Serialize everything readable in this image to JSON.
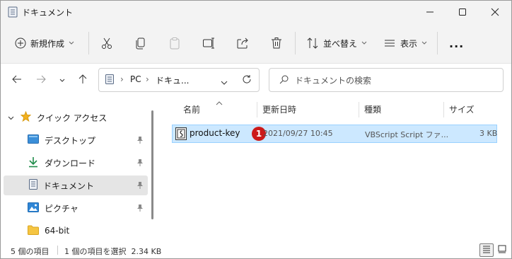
{
  "window": {
    "title": "ドキュメント",
    "title_icon": "document-folder-icon"
  },
  "toolbar": {
    "new_label": "新規作成",
    "sort_label": "並べ替え",
    "view_label": "表示",
    "more_label": "..."
  },
  "address": {
    "segments": [
      "PC",
      "ドキュ..."
    ]
  },
  "search": {
    "placeholder": "ドキュメントの検索"
  },
  "navpane": {
    "items": [
      {
        "label": "クイック アクセス",
        "icon": "star-icon"
      },
      {
        "label": "デスクトップ",
        "icon": "desktop-icon"
      },
      {
        "label": "ダウンロード",
        "icon": "download-icon"
      },
      {
        "label": "ドキュメント",
        "icon": "document-icon"
      },
      {
        "label": "ピクチャ",
        "icon": "picture-icon"
      },
      {
        "label": "64-bit",
        "icon": "folder-icon"
      }
    ]
  },
  "columns": [
    "名前",
    "更新日時",
    "種類",
    "サイズ"
  ],
  "files": [
    {
      "name": "product-key",
      "modified": "2021/09/27 10:45",
      "type": "VBScript Script ファ...",
      "size": "3 KB",
      "icon": "vbscript-file-icon"
    }
  ],
  "annotation": {
    "marker": "1"
  },
  "status": {
    "item_count": "5 個の項目",
    "selection": "1 個の項目を選択  2.34 KB"
  },
  "colors": {
    "selection_bg": "#cce8ff",
    "selection_border": "#99d1ff",
    "badge": "#cc1a1a",
    "accent": "#0067c0"
  }
}
